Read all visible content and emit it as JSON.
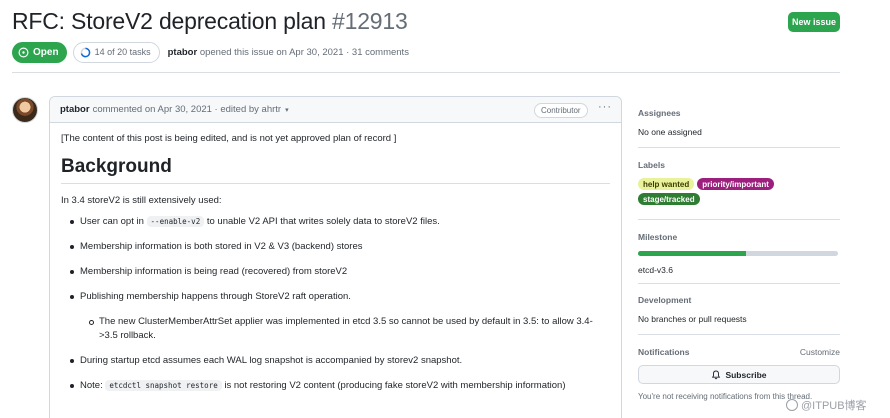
{
  "header": {
    "title": "RFC: StoreV2 deprecation plan",
    "number": "#12913",
    "new_issue_label": "New issue",
    "status": "Open",
    "tasks": "14 of 20 tasks",
    "author": "ptabor",
    "opened_text": "opened this issue on Apr 30, 2021 · 31 comments"
  },
  "comment": {
    "author": "ptabor",
    "meta": "commented on Apr 30, 2021 · edited by ahrtr",
    "caret": "▾",
    "badge": "Contributor",
    "menu": "···",
    "note": "[The content of this post is being edited, and is not yet approved plan of record ]",
    "heading": "Background",
    "intro": "In 3.4 storeV2 is still extensively used:",
    "items": [
      {
        "pre": "User can opt in ",
        "code": "--enable-v2",
        "post": " to unable V2 API that writes solely data to storeV2 files."
      },
      {
        "pre": "Membership information is both stored in V2 & V3 (backend) stores"
      },
      {
        "pre": "Membership information is being read (recovered) from storeV2"
      },
      {
        "pre": "Publishing membership happens through StoreV2 raft operation."
      },
      {
        "pre": "The new ClusterMemberAttrSet applier was implemented in etcd 3.5 so cannot be used by default in 3.5: to allow 3.4->3.5 rollback."
      },
      {
        "pre": "During startup etcd assumes each WAL log snapshot is accompanied by storev2 snapshot."
      },
      {
        "pre": "Note: ",
        "code": "etcdctl snapshot restore",
        "post": " is not restoring V2 content (producing fake storeV2 with membership information)"
      }
    ]
  },
  "sidebar": {
    "assignees_title": "Assignees",
    "assignees_value": "No one assigned",
    "labels_title": "Labels",
    "labels": [
      {
        "text": "help wanted",
        "bg": "#e9f29b",
        "fg": "#3b3b00"
      },
      {
        "text": "priority/important",
        "bg": "#9c1f7e",
        "fg": "#ffffff"
      },
      {
        "text": "stage/tracked",
        "bg": "#2e7d32",
        "fg": "#ffffff"
      }
    ],
    "milestone_title": "Milestone",
    "milestone_progress": 0.54,
    "milestone_value": "etcd-v3.6",
    "development_title": "Development",
    "development_value": "No branches or pull requests",
    "notifications_title": "Notifications",
    "customize": "Customize",
    "subscribe": "Subscribe",
    "notifications_note": "You're not receiving notifications from this thread."
  },
  "watermark": "@ITPUB博客",
  "colors": {
    "accent": "#2da44e",
    "border": "#d0d7de",
    "muted": "#656d76"
  }
}
